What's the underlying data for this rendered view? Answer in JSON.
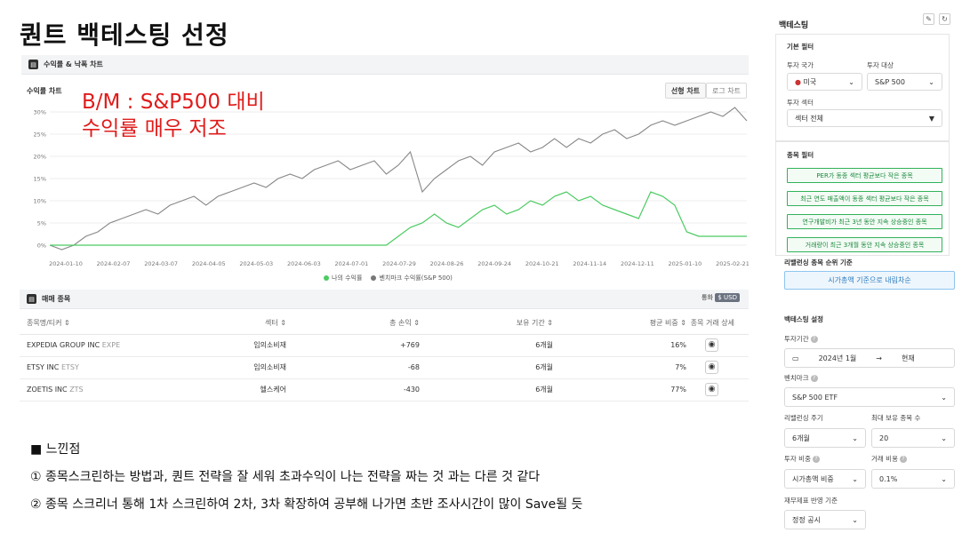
{
  "page_title": "퀀트 백테스팅 선정",
  "chart_panel": {
    "header": "수익률 & 낙폭 차트",
    "subtitle": "수익률 차트",
    "tabs": [
      "선형 차트",
      "로그 차트"
    ],
    "annotation_line1": "B/M : S&P500 대비",
    "annotation_line2": "수익률 매우 저조",
    "legend": [
      "나의 수익률",
      "벤치마크 수익률(S&P 500)"
    ]
  },
  "chart_data": {
    "type": "line",
    "x_ticks": [
      "2024-01-10",
      "2024-02-07",
      "2024-03-07",
      "2024-04-05",
      "2024-05-03",
      "2024-06-03",
      "2024-07-01",
      "2024-07-29",
      "2024-08-26",
      "2024-09-24",
      "2024-10-21",
      "2024-11-14",
      "2024-12-11",
      "2025-01-10",
      "2025-02-21"
    ],
    "ylim": [
      -2,
      32
    ],
    "y_ticks": [
      0,
      5,
      10,
      15,
      20,
      25,
      30
    ],
    "y_tick_labels": [
      "0%",
      "5%",
      "10%",
      "15%",
      "20%",
      "25%",
      "30%"
    ],
    "series": [
      {
        "name": "벤치마크 수익률(S&P 500)",
        "color": "#888888",
        "values": [
          0,
          -1,
          0,
          2,
          3,
          5,
          6,
          7,
          8,
          7,
          9,
          10,
          11,
          9,
          11,
          12,
          13,
          14,
          13,
          15,
          16,
          15,
          17,
          18,
          19,
          17,
          18,
          19,
          16,
          18,
          21,
          12,
          15,
          17,
          19,
          20,
          18,
          21,
          22,
          23,
          21,
          22,
          24,
          22,
          24,
          23,
          25,
          26,
          24,
          25,
          27,
          28,
          27,
          28,
          29,
          30,
          29,
          31,
          28
        ]
      },
      {
        "name": "나의 수익률",
        "color": "#4ccb62",
        "values": [
          0,
          0,
          0,
          0,
          0,
          0,
          0,
          0,
          0,
          0,
          0,
          0,
          0,
          0,
          0,
          0,
          0,
          0,
          0,
          0,
          0,
          0,
          0,
          0,
          0,
          0,
          0,
          0,
          0,
          2,
          4,
          5,
          7,
          5,
          4,
          6,
          8,
          9,
          7,
          8,
          10,
          9,
          11,
          12,
          10,
          11,
          9,
          8,
          7,
          6,
          12,
          11,
          9,
          3,
          2,
          2,
          2,
          2,
          2
        ]
      }
    ]
  },
  "trades_panel": {
    "header": "매매 종목",
    "currency_label": "통화",
    "currency": "$ USD",
    "columns": [
      "종목명/티커 ⇕",
      "섹터 ⇕",
      "총 손익 ⇕",
      "보유 기간 ⇕",
      "평균 비중 ⇕",
      "종목 거래 상세"
    ],
    "rows": [
      {
        "name": "EXPEDIA GROUP INC",
        "ticker": "EXPE",
        "sector": "임의소비재",
        "pnl": "+769",
        "period": "6개월",
        "weight": "16%"
      },
      {
        "name": "ETSY INC",
        "ticker": "ETSY",
        "sector": "임의소비재",
        "pnl": "-68",
        "period": "6개월",
        "weight": "7%"
      },
      {
        "name": "ZOETIS INC",
        "ticker": "ZTS",
        "sector": "헬스케어",
        "pnl": "-430",
        "period": "6개월",
        "weight": "77%"
      }
    ]
  },
  "notes": {
    "heading": "■ 느낀점",
    "line1": "① 종목스크린하는 방법과, 퀀트 전략을 잘 세워 초과수익이 나는 전략을 짜는 것 과는 다른 것 같다",
    "line2": "② 종목 스크리너 통해 1차 스크린하여 2차, 3차 확장하여 공부해 나가면 초반 조사시간이 많이 Save될 듯"
  },
  "sidebar": {
    "title": "백테스팅",
    "basic_filter": "기본 필터",
    "country_label": "투자 국가",
    "country_value": "미국",
    "target_label": "투자 대상",
    "target_value": "S&P 500",
    "sector_label": "투자 섹터",
    "sector_value": "섹터 전체",
    "stock_filter": "종목 필터",
    "filters": [
      "PER가 동종 섹터 평균보다 작은 종목",
      "최근 연도 매출액이 동종 섹터 평균보다 작은 종목",
      "연구개발비가 최근 3년 동안 지속 상승중인 종목",
      "거래량이 최근 3개월 동안 지속 상승중인 종목"
    ],
    "rebalance_rank_label": "리밸런싱 종목 순위 기준",
    "rebalance_rank_value": "시가총액 기준으로 내림차순",
    "settings_title": "백테스팅 설정",
    "period_label": "투자기간",
    "period_start": "2024년 1월",
    "period_arrow": "→",
    "period_end": "현재",
    "benchmark_label": "벤치마크",
    "benchmark_value": "S&P 500 ETF",
    "rebalance_cycle_label": "리밸런싱 주기",
    "rebalance_cycle_value": "6개월",
    "max_holdings_label": "최대 보유 종목 수",
    "max_holdings_value": "20",
    "weight_label": "투자 비중",
    "weight_value": "시가총액 비중",
    "fee_label": "거래 비용",
    "fee_value": "0.1%",
    "financial_label": "재무제표 반영 기준",
    "financial_value": "정정 공시"
  }
}
